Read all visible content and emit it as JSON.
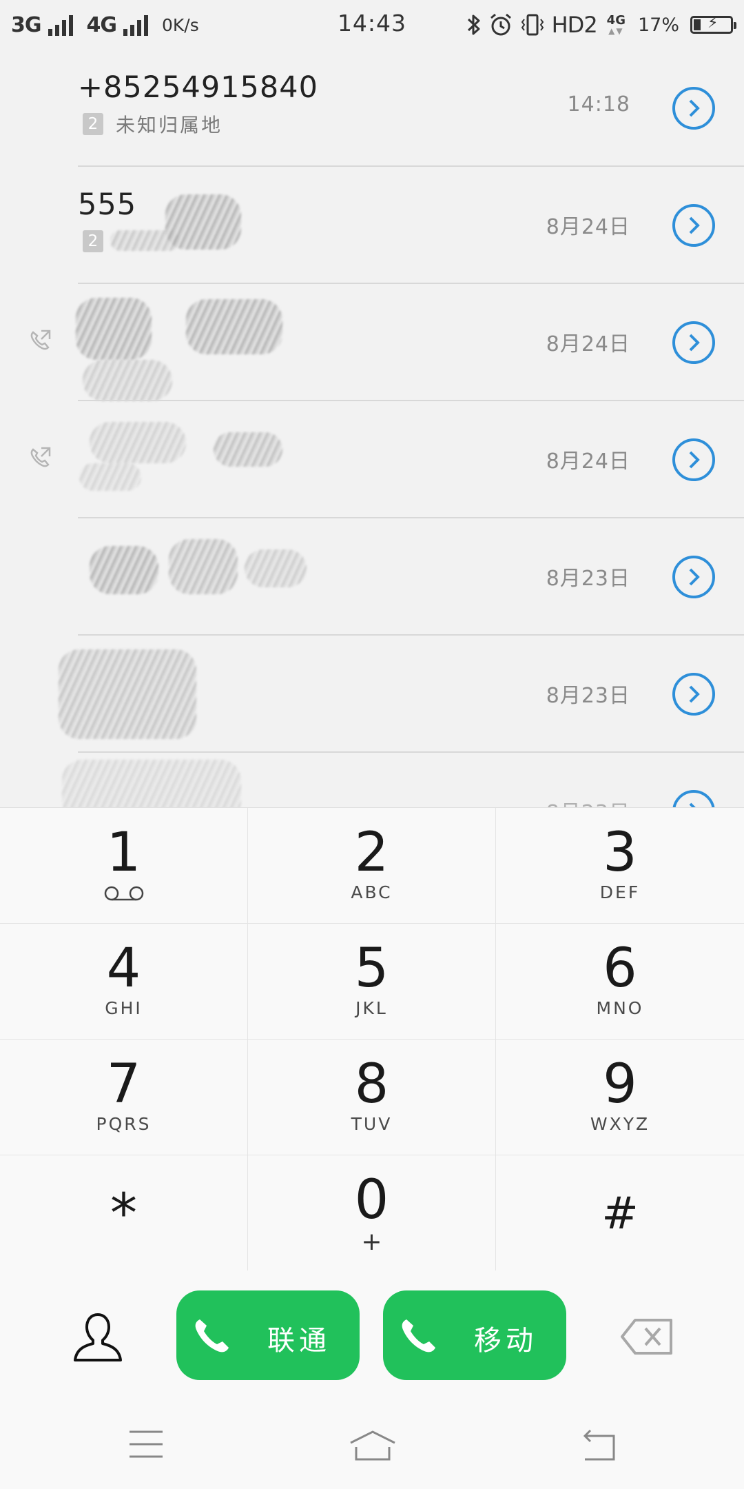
{
  "status_bar": {
    "sim1_network": "3G",
    "sim2_network": "4G",
    "net_speed": "0K/s",
    "time": "14:43",
    "hd_label": "HD2",
    "data_network": "4G",
    "battery_percent": "17%"
  },
  "call_log": [
    {
      "number": "+85254915840",
      "sim": "2",
      "location": "未知归属地",
      "time": "14:18"
    },
    {
      "number": "555",
      "sim": "2",
      "location": "",
      "time": "8月24日"
    },
    {
      "number": "",
      "sim": "",
      "location": "",
      "time": "8月24日"
    },
    {
      "number": "",
      "sim": "",
      "location": "",
      "time": "8月24日"
    },
    {
      "number": "",
      "sim": "",
      "location": "",
      "time": "8月23日"
    },
    {
      "number": "",
      "sim": "",
      "location": "",
      "time": "8月23日"
    }
  ],
  "dialpad": {
    "keys": [
      {
        "digit": "1",
        "letters": ""
      },
      {
        "digit": "2",
        "letters": "ABC"
      },
      {
        "digit": "3",
        "letters": "DEF"
      },
      {
        "digit": "4",
        "letters": "GHI"
      },
      {
        "digit": "5",
        "letters": "JKL"
      },
      {
        "digit": "6",
        "letters": "MNO"
      },
      {
        "digit": "7",
        "letters": "PQRS"
      },
      {
        "digit": "8",
        "letters": "TUV"
      },
      {
        "digit": "9",
        "letters": "WXYZ"
      },
      {
        "digit": "*",
        "letters": ""
      },
      {
        "digit": "0",
        "letters": "+"
      },
      {
        "digit": "#",
        "letters": ""
      }
    ]
  },
  "actions": {
    "call_sim1_label": "联通",
    "call_sim2_label": "移动"
  },
  "colors": {
    "accent_blue": "#2e8fd9",
    "call_green": "#21c15b"
  },
  "icons": {
    "contacts": "person-icon",
    "backspace": "backspace-icon",
    "phone": "phone-icon",
    "detail": "chevron-right-circle-icon",
    "outgoing": "outgoing-call-icon",
    "voicemail": "voicemail-icon",
    "nav_menu": "menu-icon",
    "nav_home": "home-icon",
    "nav_back": "back-icon"
  }
}
